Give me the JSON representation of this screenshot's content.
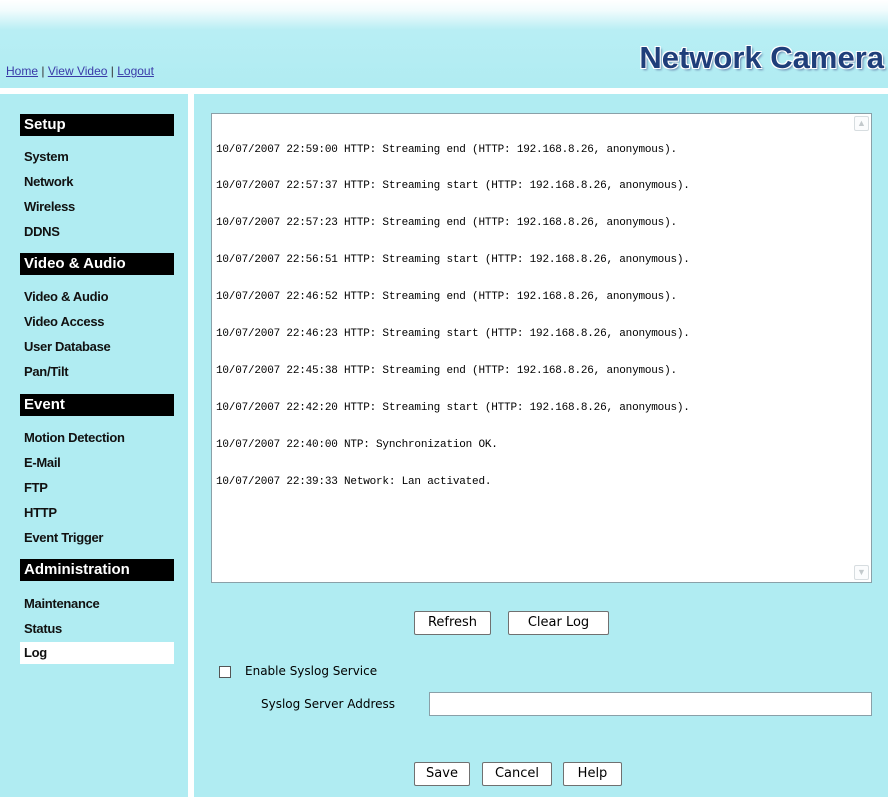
{
  "header": {
    "links": [
      "Home",
      "View Video",
      "Logout"
    ],
    "separator": " | ",
    "brand": "Network Camera"
  },
  "sidebar": {
    "sections": [
      {
        "title": "Setup",
        "items": [
          "System",
          "Network",
          "Wireless",
          "DDNS"
        ]
      },
      {
        "title": "Video & Audio",
        "items": [
          "Video & Audio",
          "Video Access",
          "User Database",
          "Pan/Tilt"
        ]
      },
      {
        "title": "Event",
        "items": [
          "Motion Detection",
          "E-Mail",
          "FTP",
          "HTTP",
          "Event Trigger"
        ]
      },
      {
        "title": "Administration",
        "items": [
          "Maintenance",
          "Status",
          "Log"
        ]
      }
    ],
    "active_item": "Log"
  },
  "log": {
    "lines": [
      "10/07/2007 22:59:00 HTTP: Streaming end (HTTP: 192.168.8.26, anonymous).",
      "10/07/2007 22:57:37 HTTP: Streaming start (HTTP: 192.168.8.26, anonymous).",
      "10/07/2007 22:57:23 HTTP: Streaming end (HTTP: 192.168.8.26, anonymous).",
      "10/07/2007 22:56:51 HTTP: Streaming start (HTTP: 192.168.8.26, anonymous).",
      "10/07/2007 22:46:52 HTTP: Streaming end (HTTP: 192.168.8.26, anonymous).",
      "10/07/2007 22:46:23 HTTP: Streaming start (HTTP: 192.168.8.26, anonymous).",
      "10/07/2007 22:45:38 HTTP: Streaming end (HTTP: 192.168.8.26, anonymous).",
      "10/07/2007 22:42:20 HTTP: Streaming start (HTTP: 192.168.8.26, anonymous).",
      "10/07/2007 22:40:00 NTP: Synchronization OK.",
      "10/07/2007 22:39:33 Network: Lan activated."
    ]
  },
  "buttons": {
    "refresh": "Refresh",
    "clear_log": "Clear Log",
    "save": "Save",
    "cancel": "Cancel",
    "help": "Help"
  },
  "syslog": {
    "enable_label": "Enable Syslog Service",
    "enabled": false,
    "server_label": "Syslog Server Address",
    "server_value": ""
  },
  "colors": {
    "background": "#b0ecf2",
    "section_header_bg": "#000000",
    "link": "#3a3aa8",
    "brand": "#1f3e7a"
  }
}
